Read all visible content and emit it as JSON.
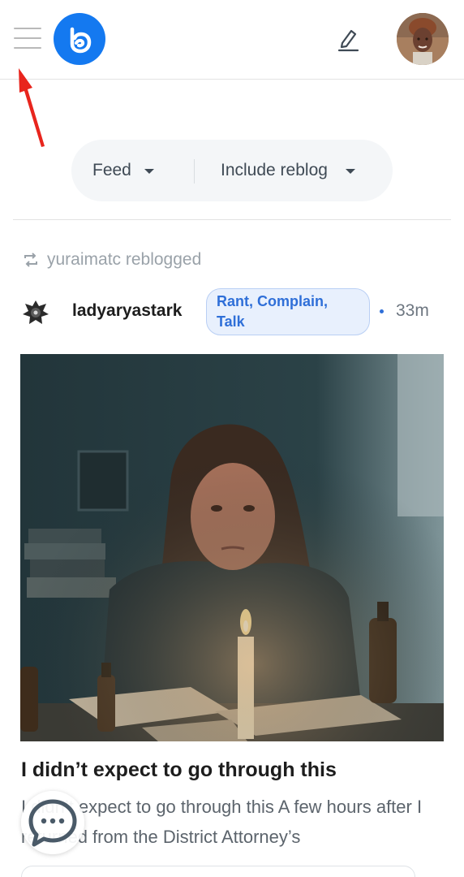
{
  "filters": {
    "feed_label": "Feed",
    "reblog_label": "Include reblog"
  },
  "post": {
    "reblogged_by": "yuraimatc reblogged",
    "author": "ladyaryastark",
    "tag": "Rant, Complain, Talk",
    "time": "33m",
    "title": "I didn’t expect to go through this",
    "excerpt": "I didn’t expect to go through this A few hours after I returned from the District Attorney’s"
  },
  "icons": {
    "menu": "hamburger-menu-icon",
    "logo": "app-logo-icon",
    "edit": "pencil-edit-icon",
    "reblog": "reblog-icon",
    "chat": "chat-bubble-icon",
    "annotation": "red-arrow-icon"
  },
  "colors": {
    "brand": "#1479f0",
    "tag_bg": "#e8f0fd",
    "tag_text": "#2f6fd8",
    "annotation": "#e8251d"
  }
}
